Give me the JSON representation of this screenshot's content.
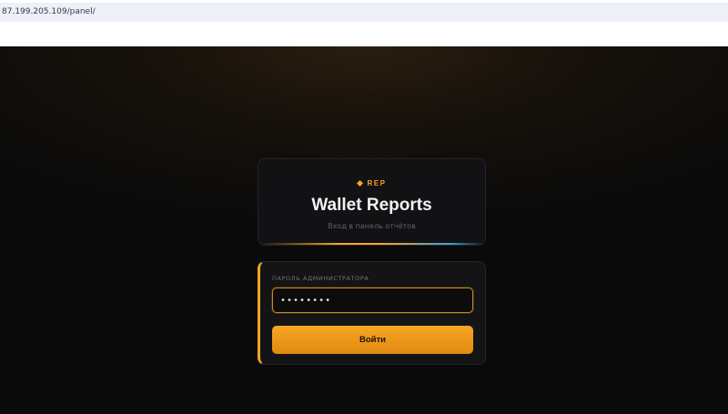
{
  "browser": {
    "url": "87.199.205.109/panel/"
  },
  "header": {
    "badge": "REP",
    "title": "Wallet Reports",
    "subtitle": "Вход в панель отчётов"
  },
  "login": {
    "field_label": "ПАРОЛЬ АДМИНИСТРАТОРА",
    "password_value": "••••••••",
    "submit_label": "Войти"
  },
  "colors": {
    "accent": "#f5a623",
    "accent_secondary": "#3aa0d8",
    "background": "#0b0b0c",
    "card": "#141416"
  },
  "icons": {
    "badge_icon": "diamond-icon"
  }
}
